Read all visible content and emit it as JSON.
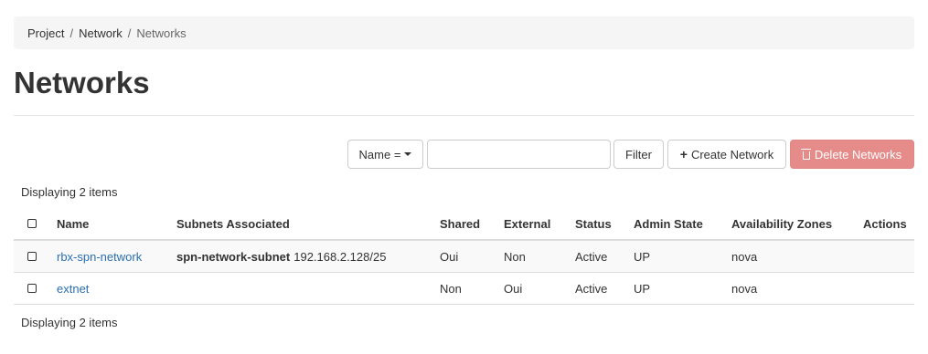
{
  "breadcrumb": {
    "items": [
      "Project",
      "Network",
      "Networks"
    ],
    "separator": "/"
  },
  "page": {
    "title": "Networks"
  },
  "toolbar": {
    "filter_field_label": "Name =",
    "filter_input_value": "",
    "filter_button": "Filter",
    "create_button": "Create Network",
    "delete_button": "Delete Networks"
  },
  "table": {
    "count_top": "Displaying 2 items",
    "count_bottom": "Displaying 2 items",
    "columns": [
      "Name",
      "Subnets Associated",
      "Shared",
      "External",
      "Status",
      "Admin State",
      "Availability Zones",
      "Actions"
    ],
    "rows": [
      {
        "name": "rbx-spn-network",
        "subnet_name": "spn-network-subnet",
        "subnet_cidr": "192.168.2.128/25",
        "shared": "Oui",
        "external": "Non",
        "status": "Active",
        "admin_state": "UP",
        "availability_zones": "nova",
        "actions": ""
      },
      {
        "name": "extnet",
        "subnet_name": "",
        "subnet_cidr": "",
        "shared": "Non",
        "external": "Oui",
        "status": "Active",
        "admin_state": "UP",
        "availability_zones": "nova",
        "actions": ""
      }
    ]
  },
  "colors": {
    "link": "#2a6fb0",
    "danger_button": "#e58c8a",
    "breadcrumb_bg": "#f5f5f5",
    "row_stripe": "#f9f9f9"
  },
  "icons": {
    "caret": "caret-down-icon",
    "create": "plus-icon",
    "delete": "trash-icon"
  }
}
